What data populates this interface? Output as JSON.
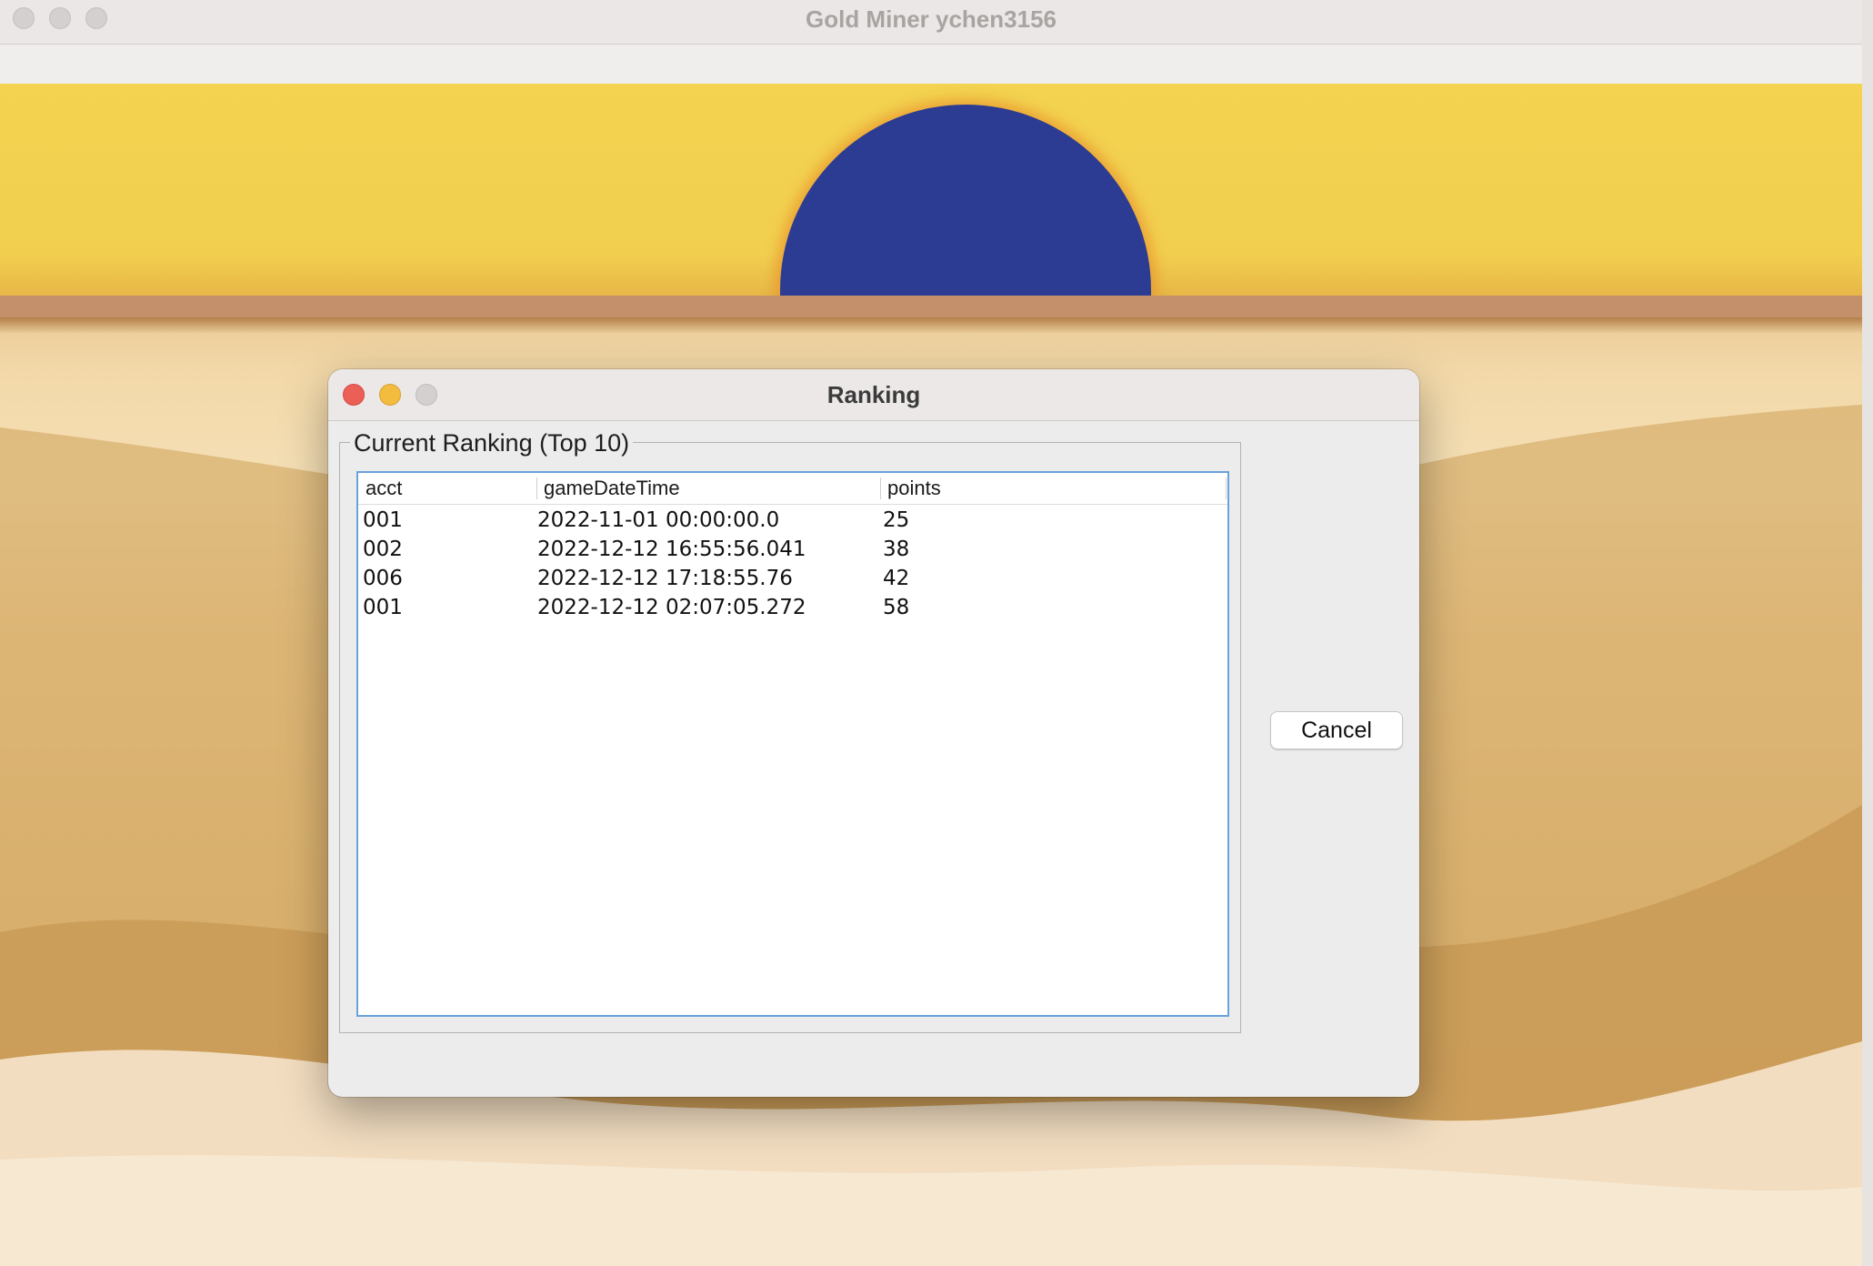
{
  "window": {
    "title": "Gold Miner ychen3156"
  },
  "dialog": {
    "title": "Ranking",
    "group_label": "Current Ranking (Top 10)",
    "cancel_label": "Cancel"
  },
  "table": {
    "headers": [
      "acct",
      "gameDateTime",
      "points"
    ],
    "rows": [
      [
        "001",
        "2022-11-01 00:00:00.0",
        "25"
      ],
      [
        "002",
        "2022-12-12 16:55:56.041",
        "38"
      ],
      [
        "006",
        "2022-12-12 17:18:55.76",
        "42"
      ],
      [
        "001",
        "2022-12-12 02:07:05.272",
        "58"
      ]
    ]
  },
  "colors": {
    "sky": "#f3d350",
    "sun": "#2c3c93",
    "sand": "#ddb370",
    "dialog_bg": "#ececec",
    "table_focus_border": "#6aa2db"
  }
}
